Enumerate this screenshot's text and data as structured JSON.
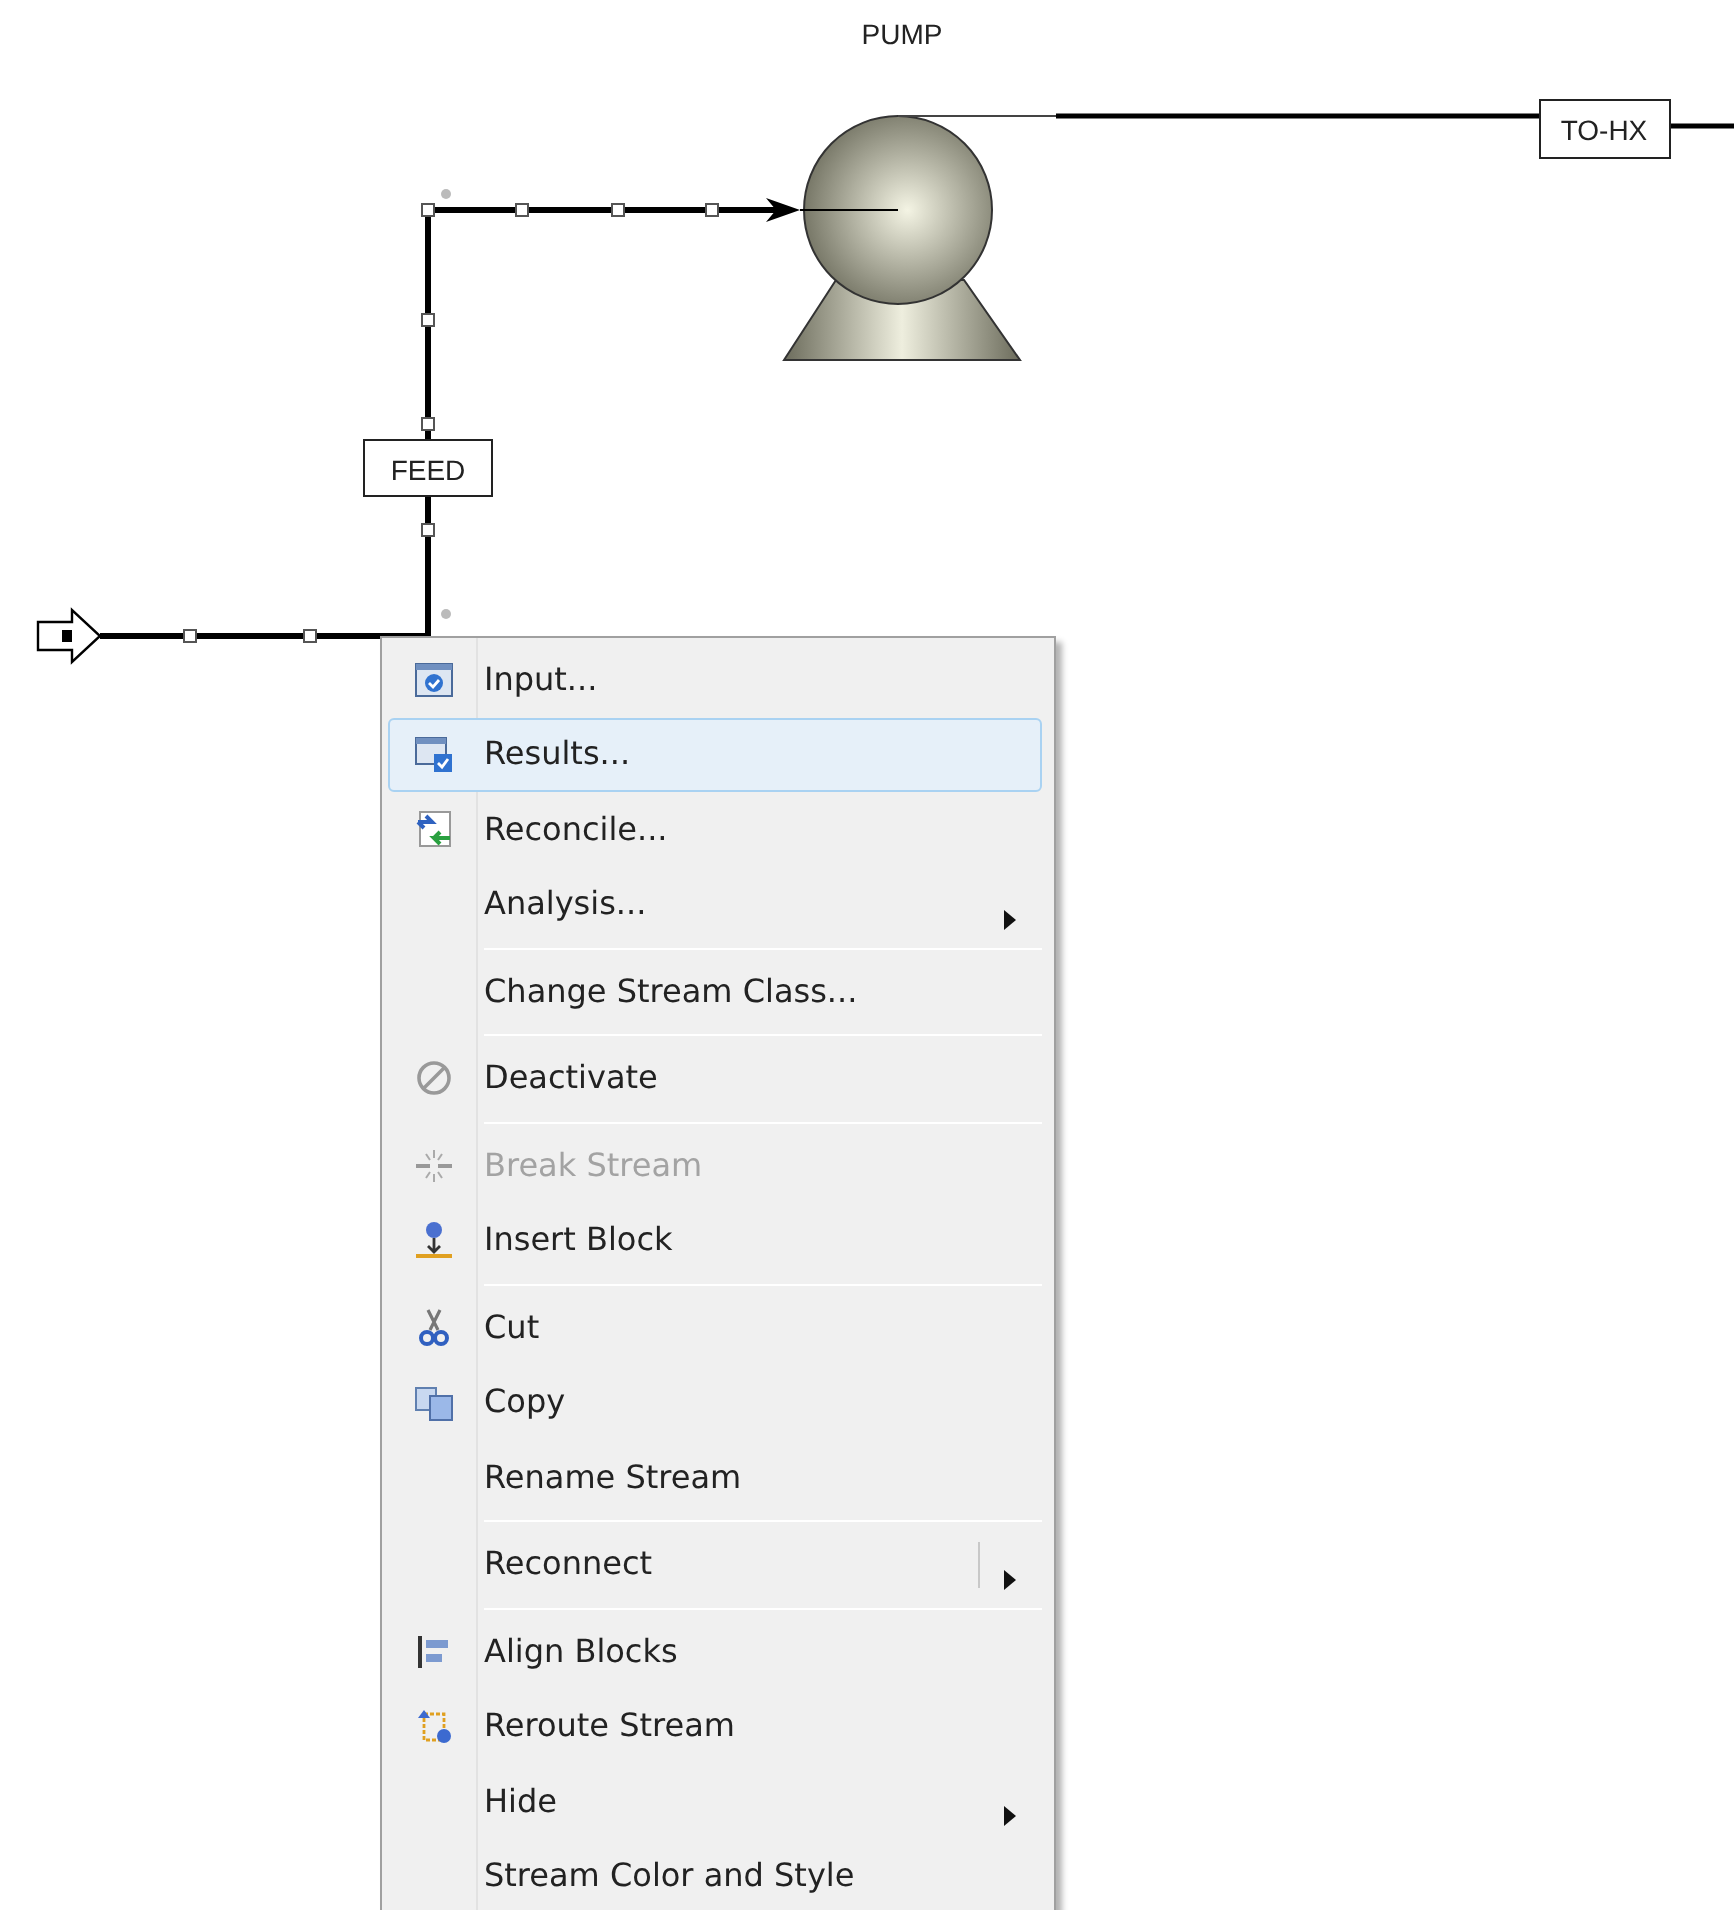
{
  "flowsheet": {
    "blocks": [
      {
        "label": "PUMP"
      }
    ],
    "streams": [
      {
        "label": "FEED",
        "selected": true
      },
      {
        "label": "TO-HX",
        "selected": false
      }
    ]
  },
  "context_menu": {
    "items": [
      {
        "kind": "item",
        "label": "Input...",
        "selected": false,
        "disabled": false,
        "submenu": false,
        "split": false
      },
      {
        "kind": "item",
        "label": "Results...",
        "selected": true,
        "disabled": false,
        "submenu": false,
        "split": false
      },
      {
        "kind": "item",
        "label": "Reconcile...",
        "selected": false,
        "disabled": false,
        "submenu": false,
        "split": false
      },
      {
        "kind": "item",
        "label": "Analysis...",
        "selected": false,
        "disabled": false,
        "submenu": true,
        "split": false
      },
      {
        "kind": "separator"
      },
      {
        "kind": "item",
        "label": "Change Stream Class...",
        "selected": false,
        "disabled": false,
        "submenu": false,
        "split": false
      },
      {
        "kind": "separator"
      },
      {
        "kind": "item",
        "label": "Deactivate",
        "selected": false,
        "disabled": false,
        "submenu": false,
        "split": false
      },
      {
        "kind": "separator"
      },
      {
        "kind": "item",
        "label": "Break Stream",
        "selected": false,
        "disabled": true,
        "submenu": false,
        "split": false
      },
      {
        "kind": "item",
        "label": "Insert Block",
        "selected": false,
        "disabled": false,
        "submenu": false,
        "split": false
      },
      {
        "kind": "separator"
      },
      {
        "kind": "item",
        "label": "Cut",
        "selected": false,
        "disabled": false,
        "submenu": false,
        "split": false
      },
      {
        "kind": "item",
        "label": "Copy",
        "selected": false,
        "disabled": false,
        "submenu": false,
        "split": false
      },
      {
        "kind": "item",
        "label": "Rename Stream",
        "selected": false,
        "disabled": false,
        "submenu": false,
        "split": false
      },
      {
        "kind": "separator"
      },
      {
        "kind": "item",
        "label": "Reconnect",
        "selected": false,
        "disabled": false,
        "submenu": true,
        "split": true
      },
      {
        "kind": "separator"
      },
      {
        "kind": "item",
        "label": "Align Blocks",
        "selected": false,
        "disabled": false,
        "submenu": false,
        "split": false
      },
      {
        "kind": "item",
        "label": "Reroute Stream",
        "selected": false,
        "disabled": false,
        "submenu": false,
        "split": false
      },
      {
        "kind": "item",
        "label": "Hide",
        "selected": false,
        "disabled": false,
        "submenu": true,
        "split": false
      },
      {
        "kind": "item",
        "label": "Stream Color and Style",
        "selected": false,
        "disabled": false,
        "submenu": false,
        "split": false
      }
    ]
  }
}
